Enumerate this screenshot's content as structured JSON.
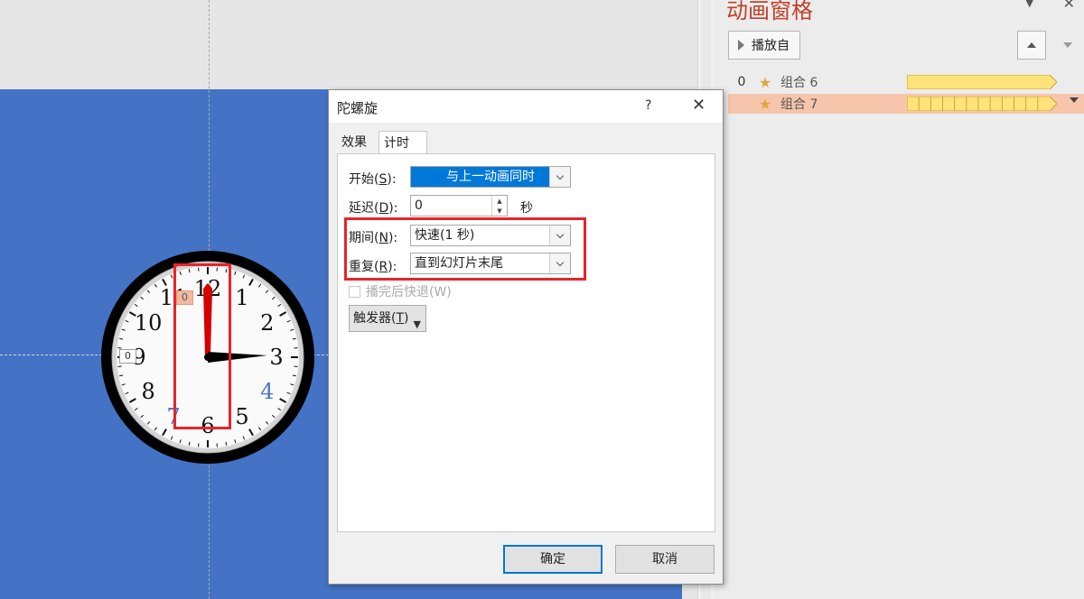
{
  "colors": {
    "slide_bg": "#4472c4",
    "accent_blue": "#0078d7",
    "highlight_red": "#e8232a",
    "panel_title": "#c0412b",
    "selected_row": "#f6c5ac",
    "timeline_bar": "#ffe27a"
  },
  "clock": {
    "numbers": [
      "12",
      "1",
      "2",
      "3",
      "4",
      "5",
      "6",
      "7",
      "8",
      "9",
      "10",
      "11"
    ],
    "tag_red": "0",
    "tag_white": "0"
  },
  "dialog": {
    "title": "陀螺旋",
    "help": "?",
    "close_icon": "close-icon",
    "tabs": [
      "效果",
      "计时"
    ],
    "start_label": "开始(",
    "start_key": "S",
    "start_label_end": "):",
    "start_value": "与上一动画同时",
    "delay_label": "延迟(",
    "delay_key": "D",
    "delay_label_end": "):",
    "delay_value": "0",
    "delay_unit": "秒",
    "duration_label": "期间(",
    "duration_key": "N",
    "duration_label_end": "):",
    "duration_value": "快速(1 秒)",
    "repeat_label": "重复(",
    "repeat_key": "R",
    "repeat_label_end": "):",
    "repeat_value": "直到幻灯片末尾",
    "rewind_label": "播完后快退(W)",
    "trigger_label": "触发器(",
    "trigger_key": "T",
    "trigger_label_end": ")",
    "ok": "确定",
    "cancel": "取消"
  },
  "panel": {
    "title": "动画窗格",
    "play_label": "播放自",
    "items": [
      {
        "index": "0",
        "label": "组合 6",
        "selected": false,
        "segments": 1
      },
      {
        "index": "",
        "label": "组合 7",
        "selected": true,
        "segments": 12
      }
    ]
  }
}
